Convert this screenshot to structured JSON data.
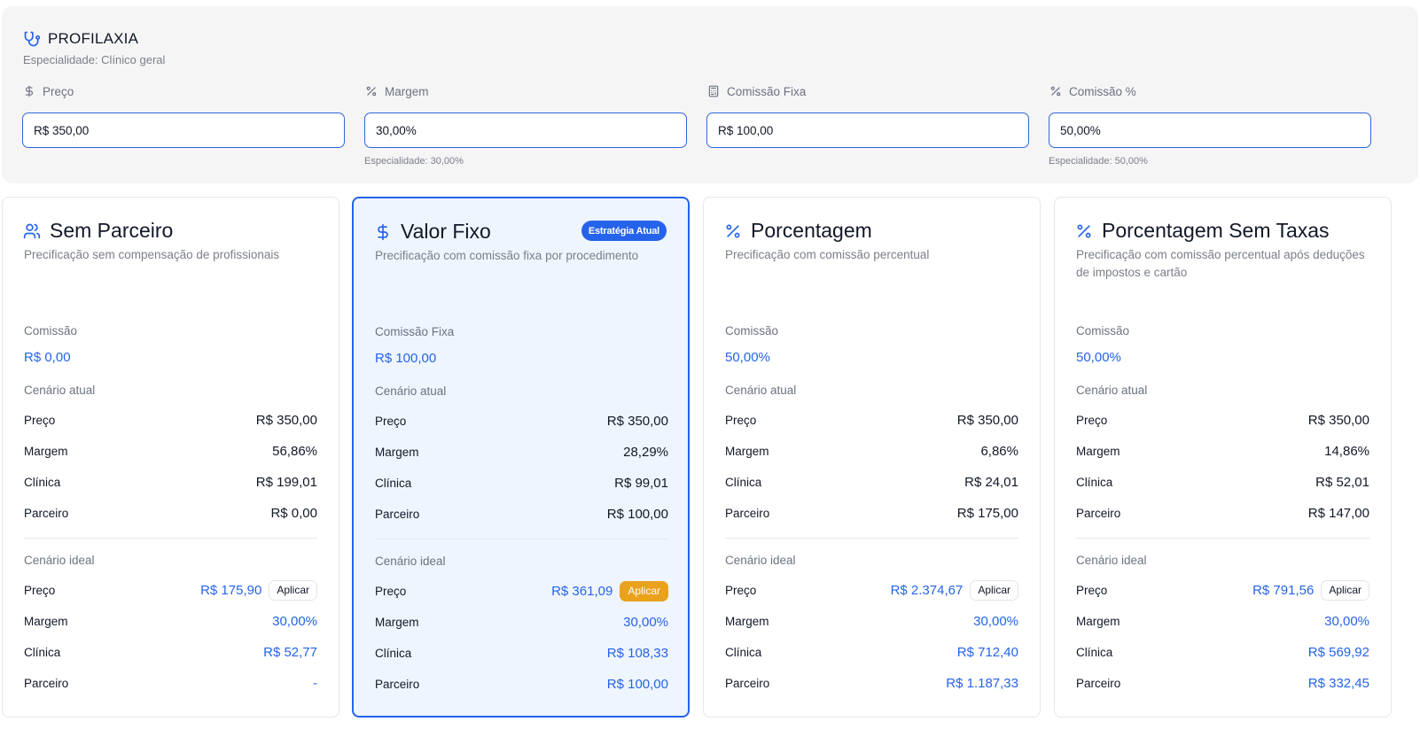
{
  "procedure": {
    "name": "PROFILAXIA",
    "specialty": "Especialidade: Clínico geral"
  },
  "fields": [
    {
      "label": "Preço",
      "icon": "dollar-icon",
      "value": "R$ 350,00",
      "hint": ""
    },
    {
      "label": "Margem",
      "icon": "percent-icon",
      "value": "30,00%",
      "hint": "Especialidade: 30,00%"
    },
    {
      "label": "Comissão Fixa",
      "icon": "calculator-icon",
      "value": "R$ 100,00",
      "hint": ""
    },
    {
      "label": "Comissão %",
      "icon": "percent-icon",
      "value": "50,00%",
      "hint": "Especialidade: 50,00%"
    }
  ],
  "cards": [
    {
      "title": "Sem Parceiro",
      "icon": "users-icon",
      "description": "Precificação sem compensação de profissionais",
      "metric_label": "Comissão",
      "metric_value": "R$ 0,00",
      "badge": "",
      "current_label": "Cenário atual",
      "current": {
        "preco_label": "Preço",
        "preco": "R$ 350,00",
        "margem_label": "Margem",
        "margem": "56,86%",
        "clinica_label": "Clínica",
        "clinica": "R$ 199,01",
        "parceiro_label": "Parceiro",
        "parceiro": "R$ 0,00"
      },
      "ideal_label": "Cenário ideal",
      "ideal": {
        "preco_label": "Preço",
        "preco": "R$ 175,90",
        "margem_label": "Margem",
        "margem": "30,00%",
        "clinica_label": "Clínica",
        "clinica": "R$ 52,77",
        "parceiro_label": "Parceiro",
        "parceiro": "-"
      },
      "apply_label": "Aplicar"
    },
    {
      "title": "Valor Fixo",
      "icon": "dollar-icon",
      "description": "Precificação com comissão fixa por procedimento",
      "metric_label": "Comissão Fixa",
      "metric_value": "R$ 100,00",
      "badge": "Estratégia Atual",
      "current_label": "Cenário atual",
      "current": {
        "preco_label": "Preço",
        "preco": "R$ 350,00",
        "margem_label": "Margem",
        "margem": "28,29%",
        "clinica_label": "Clínica",
        "clinica": "R$ 99,01",
        "parceiro_label": "Parceiro",
        "parceiro": "R$ 100,00"
      },
      "ideal_label": "Cenário ideal",
      "ideal": {
        "preco_label": "Preço",
        "preco": "R$ 361,09",
        "margem_label": "Margem",
        "margem": "30,00%",
        "clinica_label": "Clínica",
        "clinica": "R$ 108,33",
        "parceiro_label": "Parceiro",
        "parceiro": "R$ 100,00"
      },
      "apply_label": "Aplicar"
    },
    {
      "title": "Porcentagem",
      "icon": "percent-icon",
      "description": "Precificação com comissão percentual",
      "metric_label": "Comissão",
      "metric_value": "50,00%",
      "badge": "",
      "current_label": "Cenário atual",
      "current": {
        "preco_label": "Preço",
        "preco": "R$ 350,00",
        "margem_label": "Margem",
        "margem": "6,86%",
        "clinica_label": "Clínica",
        "clinica": "R$ 24,01",
        "parceiro_label": "Parceiro",
        "parceiro": "R$ 175,00"
      },
      "ideal_label": "Cenário ideal",
      "ideal": {
        "preco_label": "Preço",
        "preco": "R$ 2.374,67",
        "margem_label": "Margem",
        "margem": "30,00%",
        "clinica_label": "Clínica",
        "clinica": "R$ 712,40",
        "parceiro_label": "Parceiro",
        "parceiro": "R$ 1.187,33"
      },
      "apply_label": "Aplicar"
    },
    {
      "title": "Porcentagem Sem Taxas",
      "icon": "percent-icon",
      "description": "Precificação com comissão percentual após deduções de impostos e cartão",
      "metric_label": "Comissão",
      "metric_value": "50,00%",
      "badge": "",
      "current_label": "Cenário atual",
      "current": {
        "preco_label": "Preço",
        "preco": "R$ 350,00",
        "margem_label": "Margem",
        "margem": "14,86%",
        "clinica_label": "Clínica",
        "clinica": "R$ 52,01",
        "parceiro_label": "Parceiro",
        "parceiro": "R$ 147,00"
      },
      "ideal_label": "Cenário ideal",
      "ideal": {
        "preco_label": "Preço",
        "preco": "R$ 791,56",
        "margem_label": "Margem",
        "margem": "30,00%",
        "clinica_label": "Clínica",
        "clinica": "R$ 569,92",
        "parceiro_label": "Parceiro",
        "parceiro": "R$ 332,45"
      },
      "apply_label": "Aplicar"
    }
  ],
  "colors": {
    "accent": "#2563eb",
    "apply_primary": "#eaa11c",
    "active_card_bg": "#eff5ff"
  }
}
